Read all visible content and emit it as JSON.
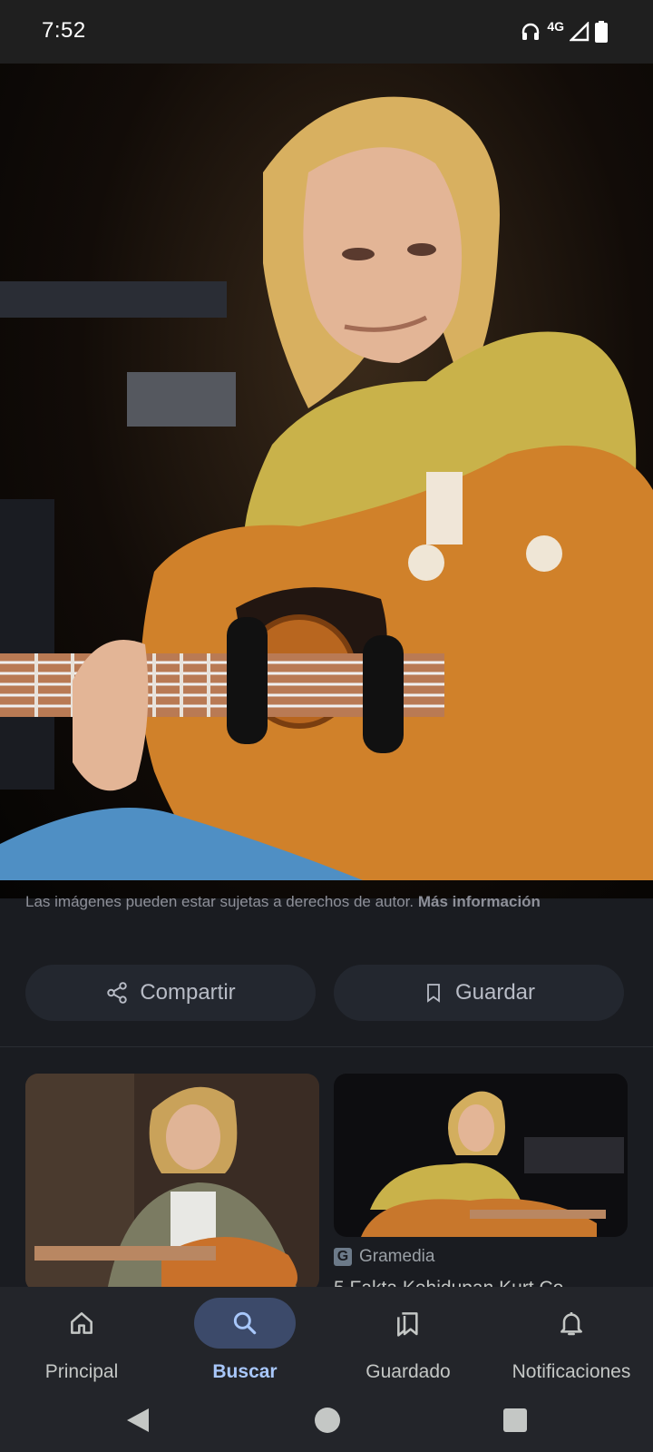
{
  "status": {
    "time": "7:52",
    "network": "4G"
  },
  "image": {
    "description_icon": "photo"
  },
  "sheet": {
    "copyright_text": "Las imágenes pueden estar sujetas a derechos de autor.",
    "more_info": "Más información",
    "share_label": "Compartir",
    "save_label": "Guardar"
  },
  "results": [
    {
      "source": "",
      "title": ""
    },
    {
      "source": "Gramedia",
      "title": "5 Fakta Kehidupan Kurt Co..."
    }
  ],
  "nav": {
    "items": [
      {
        "label": "Principal",
        "icon": "home-icon"
      },
      {
        "label": "Buscar",
        "icon": "search-icon"
      },
      {
        "label": "Guardado",
        "icon": "bookmarks-icon"
      },
      {
        "label": "Notificaciones",
        "icon": "bell-icon"
      }
    ]
  },
  "colors": {
    "accent": "#a8c7fa",
    "active_pill": "#3c4a6a",
    "background": "#1a1c21"
  }
}
